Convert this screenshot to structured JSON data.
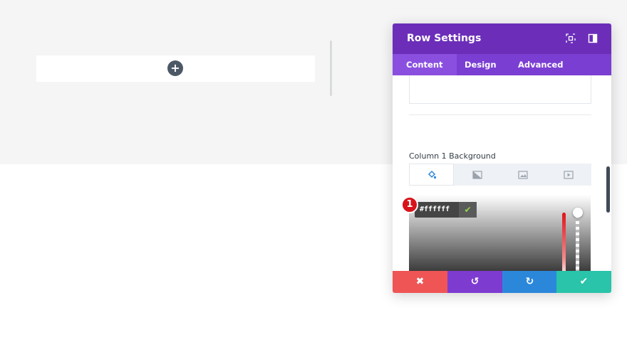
{
  "modal": {
    "title": "Row Settings",
    "header_icons": [
      "fullscreen-icon",
      "sidebar-toggle-icon"
    ],
    "tabs": [
      {
        "label": "Content",
        "active": true
      },
      {
        "label": "Design",
        "active": false
      },
      {
        "label": "Advanced",
        "active": false
      }
    ],
    "section_label": "Column 1 Background",
    "background_tabs": [
      "paint-bucket-icon",
      "gradient-icon",
      "image-icon",
      "video-icon"
    ],
    "color_picker": {
      "hex_value": "#ffffff",
      "confirm_icon": "check-icon"
    },
    "annotation_badge": "1",
    "swatch_colors": [
      "#ffffff",
      "#e02b20",
      "#e09900",
      "#edf000",
      "#7cda24",
      "#0c71c3",
      "#8300e9"
    ],
    "footer_buttons": [
      {
        "name": "cancel-button",
        "icon": "close-icon",
        "color": "#ef5555"
      },
      {
        "name": "undo-button",
        "icon": "undo-icon",
        "color": "#7e3bd0"
      },
      {
        "name": "redo-button",
        "icon": "redo-icon",
        "color": "#2b87da"
      },
      {
        "name": "save-button",
        "icon": "check-icon",
        "color": "#29c4a9"
      }
    ]
  },
  "colors": {
    "header": "#6c2eb9",
    "tabs": "#7b3ed2",
    "active_tab": "#8b4fe0",
    "badge": "#d7141a"
  }
}
